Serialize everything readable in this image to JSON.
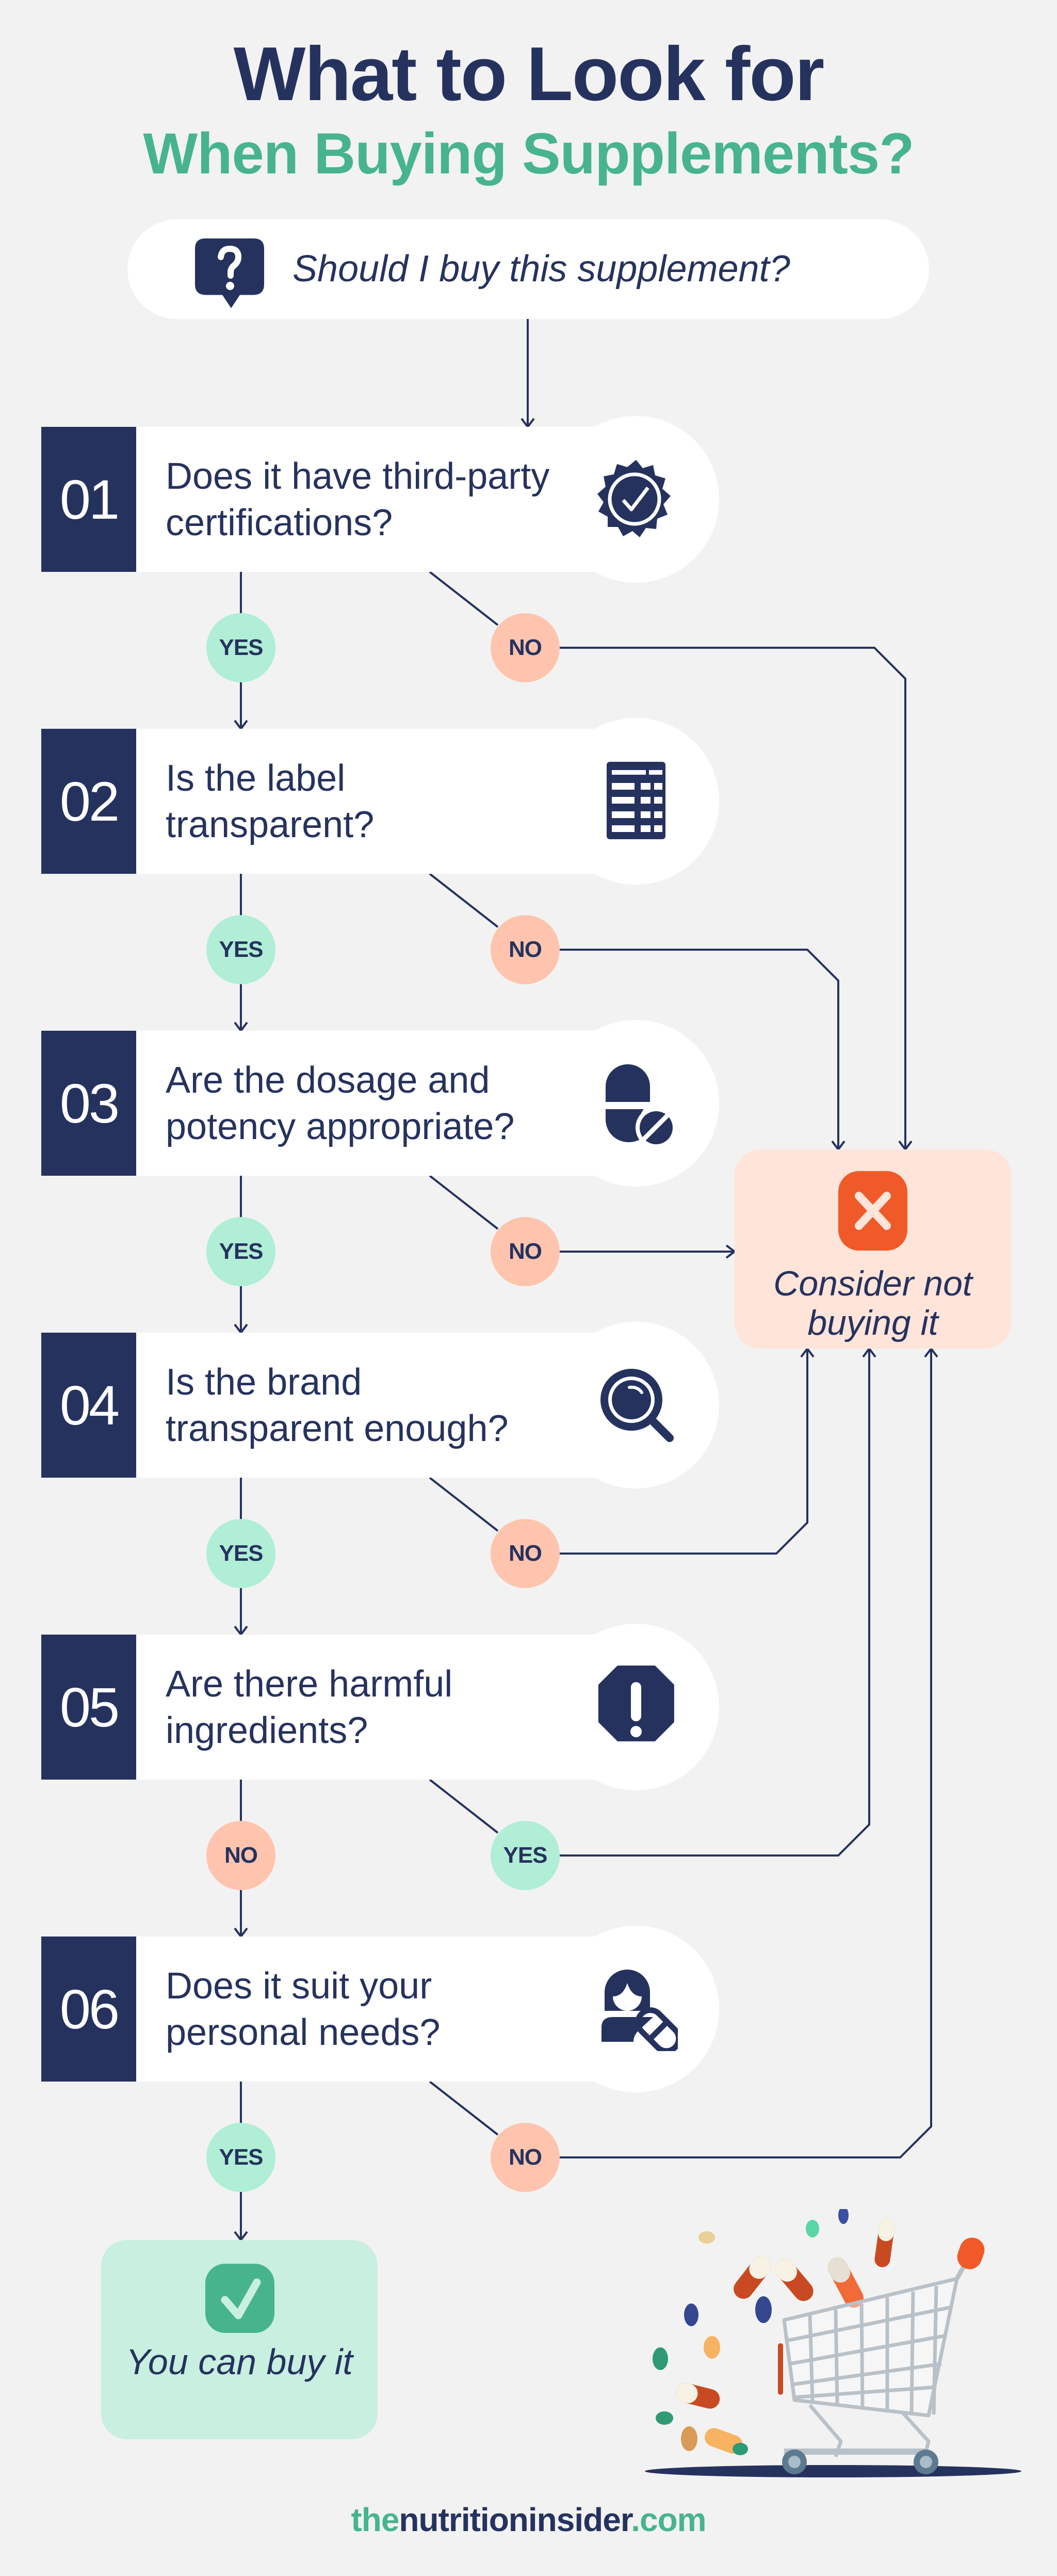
{
  "header": {
    "title": "What to Look for",
    "subtitle": "When Buying Supplements?"
  },
  "start": {
    "icon": "question-bubble-icon",
    "text": "Should I buy this supplement?"
  },
  "steps": [
    {
      "number": "01",
      "question": "Does it have third-party certifications?",
      "icon": "certified-badge-icon",
      "down_label": "YES",
      "side_label": "NO"
    },
    {
      "number": "02",
      "question": "Is the label transparent?",
      "icon": "label-table-icon",
      "down_label": "YES",
      "side_label": "NO"
    },
    {
      "number": "03",
      "question": "Are the dosage and potency appropriate?",
      "icon": "pills-icon",
      "down_label": "YES",
      "side_label": "NO"
    },
    {
      "number": "04",
      "question": "Is the brand transparent enough?",
      "icon": "magnifier-icon",
      "down_label": "YES",
      "side_label": "NO"
    },
    {
      "number": "05",
      "question": "Are there harmful ingredients?",
      "icon": "warning-octagon-icon",
      "down_label": "NO",
      "side_label": "YES"
    },
    {
      "number": "06",
      "question": "Does it suit your personal needs?",
      "icon": "person-pill-icon",
      "down_label": "YES",
      "side_label": "NO"
    }
  ],
  "outcomes": {
    "negative": {
      "icon": "x-icon",
      "text": "Consider not buying it"
    },
    "positive": {
      "icon": "check-icon",
      "text": "You can buy it"
    }
  },
  "footer": {
    "part1": "the",
    "part2": "nutritioninsider",
    "part3": ".com"
  },
  "colors": {
    "navy": "#26325e",
    "green": "#47b48e",
    "yes_badge": "#b0eed6",
    "no_badge": "#ffc4ae",
    "negative_bg": "#ffe4da",
    "negative_accent": "#f05a28",
    "positive_bg": "#c8efdf",
    "background": "#f2f2f2"
  }
}
